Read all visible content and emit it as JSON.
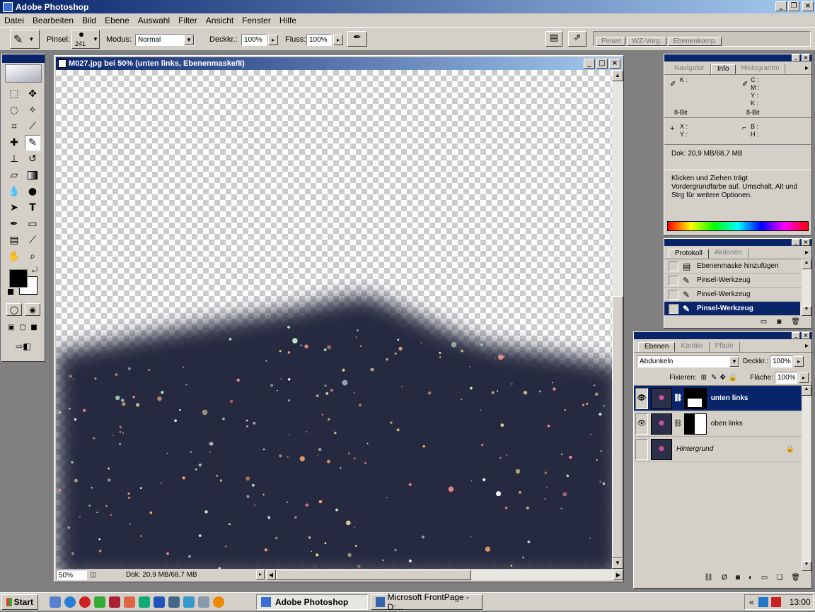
{
  "app": {
    "title": "Adobe Photoshop"
  },
  "menu": [
    "Datei",
    "Bearbeiten",
    "Bild",
    "Ebene",
    "Auswahl",
    "Filter",
    "Ansicht",
    "Fenster",
    "Hilfe"
  ],
  "options": {
    "brush_label": "Pinsel:",
    "brush_size": "241",
    "mode_label": "Modus:",
    "mode_value": "Normal",
    "opacity_label": "Deckkr.:",
    "opacity_value": "100%",
    "flow_label": "Fluss:",
    "flow_value": "100%",
    "well_tabs": [
      "Pinsel",
      "WZ-Vorg.",
      "Ebenenkomp."
    ]
  },
  "document": {
    "title": "M027.jpg bei 50% (unten links, Ebenenmaske/8)",
    "zoom": "50%",
    "doc_info": "Dok: 20,9 MB/68,7 MB"
  },
  "navigator_panel": {
    "tabs": [
      "Navigator",
      "Info",
      "Histogramm"
    ],
    "active_tab": "Info",
    "k_label": "K :",
    "c_label": "C :",
    "m_label": "M :",
    "y_label": "Y :",
    "k2_label": "K :",
    "bit_left": "8-Bit",
    "bit_right": "8-Bit",
    "x_label": "X :",
    "y2_label": "Y :",
    "b_label": "B :",
    "h_label": "H :",
    "doc_info": "Dok: 20,9 MB/68,7 MB",
    "hint": "Klicken und Ziehen trägt Vordergrundfarbe auf. Umschalt, Alt und Strg für weitere Optionen."
  },
  "history_panel": {
    "tabs": [
      "Protokoll",
      "Aktionen"
    ],
    "items": [
      "Ebenenmaske hinzufügen",
      "Pinsel-Werkzeug",
      "Pinsel-Werkzeug",
      "Pinsel-Werkzeug"
    ]
  },
  "layers_panel": {
    "tabs": [
      "Ebenen",
      "Kanäle",
      "Pfade"
    ],
    "blend_mode": "Abdunkeln",
    "opacity_label": "Deckkr.:",
    "opacity_value": "100%",
    "lock_label": "Fixieren:",
    "fill_label": "Fläche:",
    "fill_value": "100%",
    "layers": [
      "unten links",
      "oben links",
      "Hintergrund"
    ]
  },
  "taskbar": {
    "start": "Start",
    "tasks": [
      "Adobe Photoshop",
      "Microsoft FrontPage - D:..."
    ],
    "clock": "13:00"
  },
  "colors": {
    "title_blue": "#0a246a",
    "face": "#d4d0c8",
    "night": "#262a40"
  }
}
